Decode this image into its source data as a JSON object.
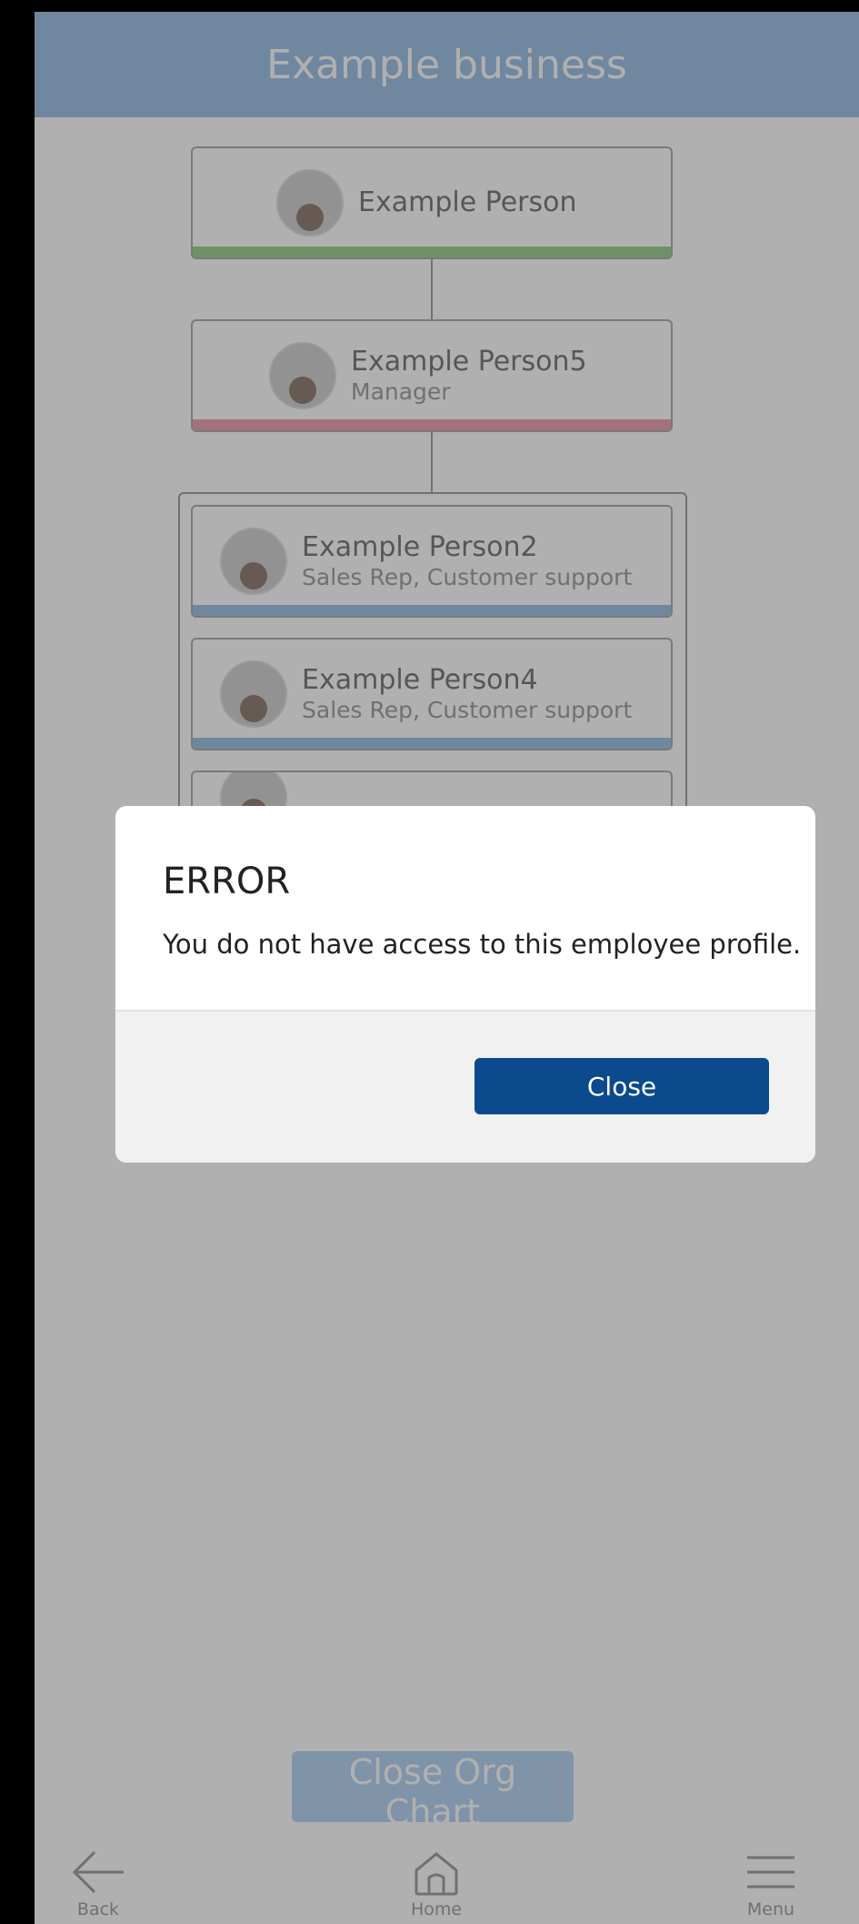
{
  "header": {
    "title": "Example business"
  },
  "org": {
    "top": {
      "name": "Example Person",
      "bar_color": "#88c77a"
    },
    "manager": {
      "name": "Example Person5",
      "role": "Manager",
      "bar_color": "#e88ca2"
    },
    "reports": [
      {
        "name": "Example Person2",
        "role": "Sales Rep, Customer support",
        "bar_color": "#8bb5e2"
      },
      {
        "name": "Example Person4",
        "role": "Sales Rep, Customer support",
        "bar_color": "#8bb5e2"
      }
    ]
  },
  "dialog": {
    "title": "ERROR",
    "message": "You do not have access to this employee profile.",
    "close_label": "Close"
  },
  "footer": {
    "close_org_label": "Close Org Chart"
  },
  "nav": {
    "back_label": "Back",
    "home_label": "Home",
    "menu_label": "Menu"
  },
  "colors": {
    "header": "#8bb5e2",
    "dialog_button": "#0b4a8c",
    "overlay": "rgba(80,80,80,0.45)"
  }
}
